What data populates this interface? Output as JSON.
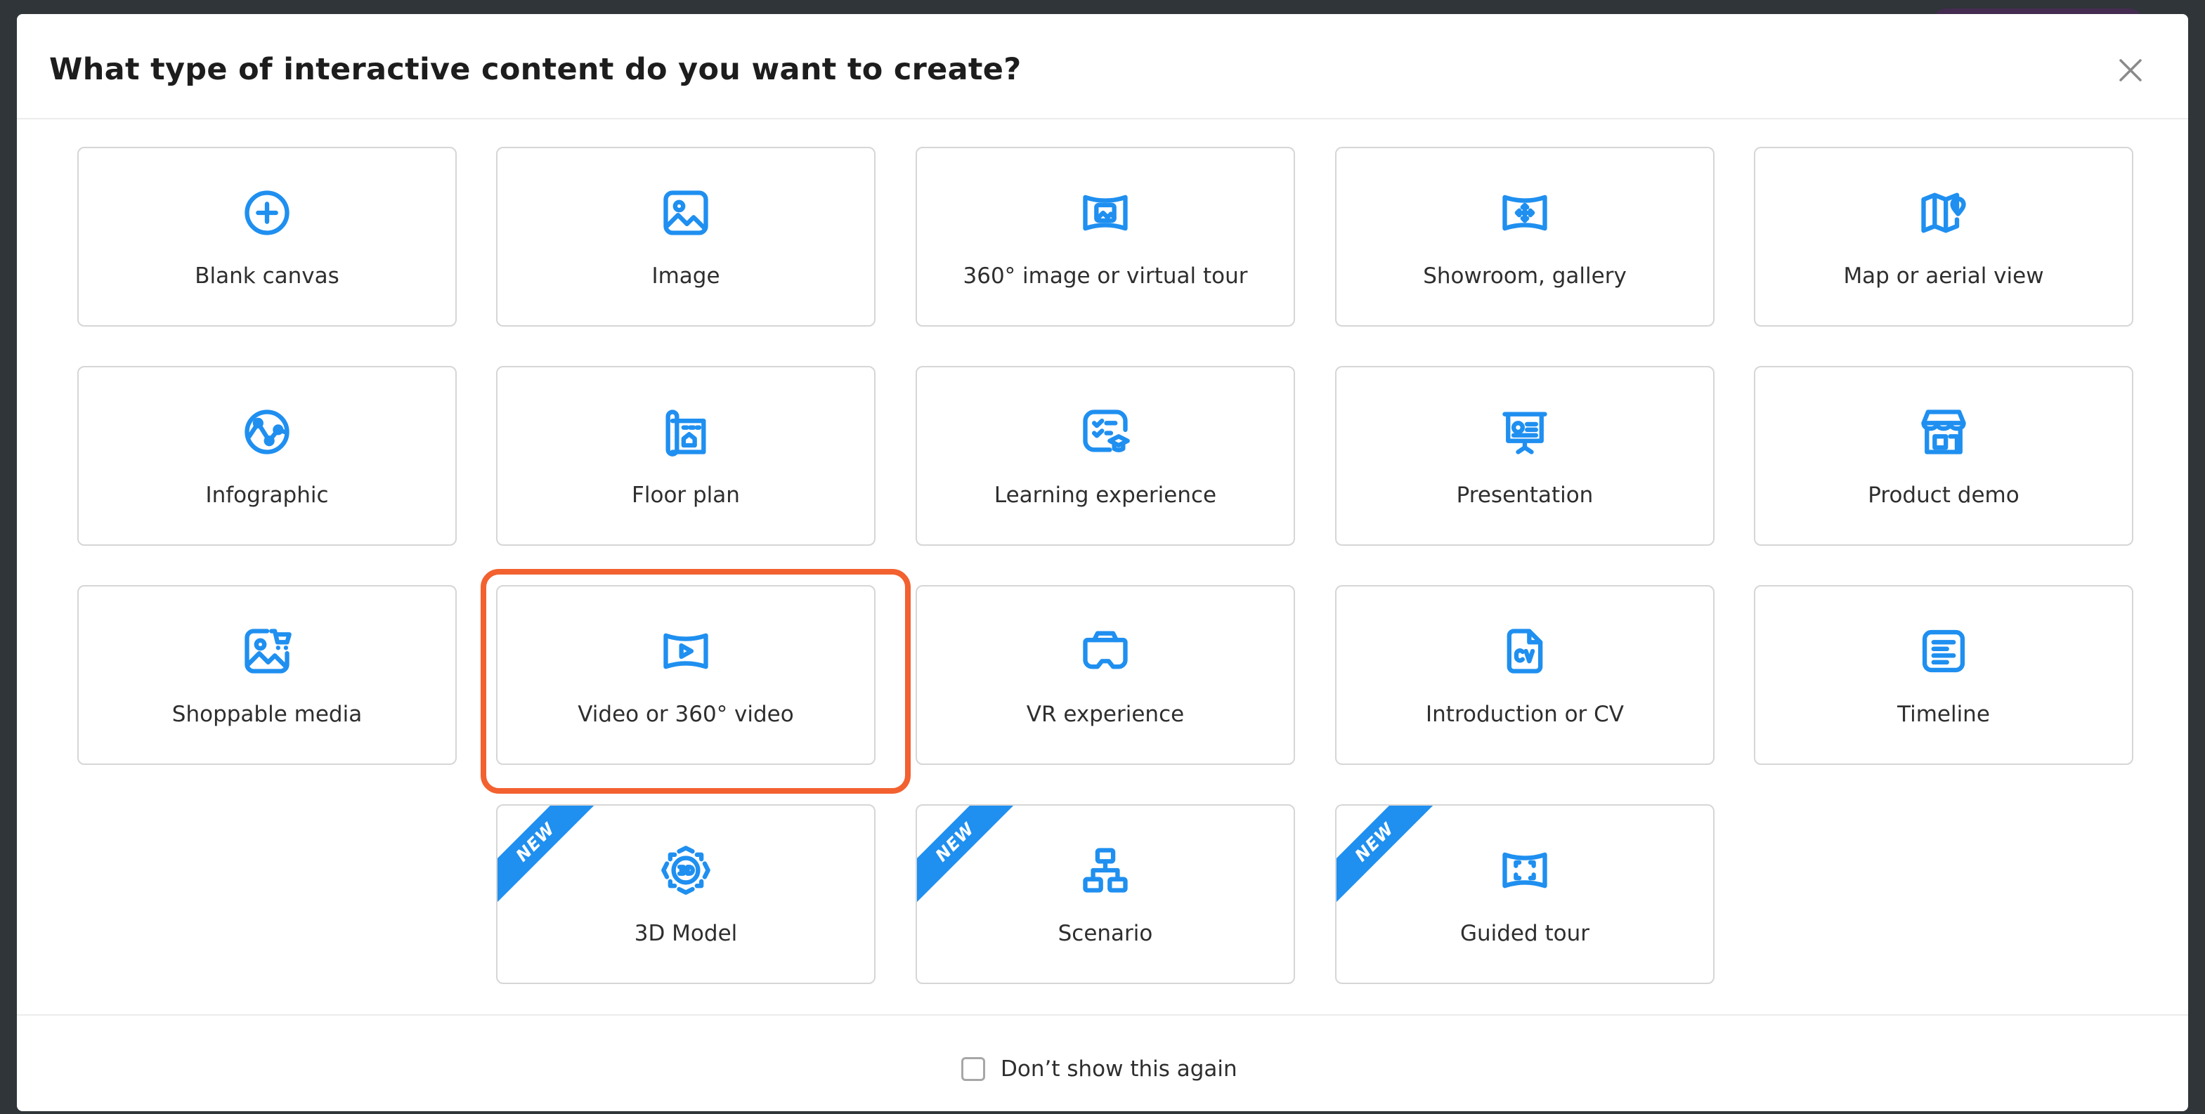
{
  "dialog": {
    "title": "What type of interactive content do you want to create?",
    "close_icon": "close-icon"
  },
  "accent_color": "#1f8ff0",
  "highlight_color": "#f2612f",
  "new_badge": "NEW",
  "cards": [
    {
      "label": "Blank canvas",
      "icon": "plus-circle-icon"
    },
    {
      "label": "Image",
      "icon": "image-icon"
    },
    {
      "label": "360° image or virtual tour",
      "icon": "panorama-image-icon"
    },
    {
      "label": "Showroom, gallery",
      "icon": "showroom-move-icon"
    },
    {
      "label": "Map or aerial view",
      "icon": "map-pin-icon"
    },
    {
      "label": "Infographic",
      "icon": "infographic-icon"
    },
    {
      "label": "Floor plan",
      "icon": "floor-plan-icon"
    },
    {
      "label": "Learning experience",
      "icon": "learning-icon"
    },
    {
      "label": "Presentation",
      "icon": "presentation-board-icon"
    },
    {
      "label": "Product demo",
      "icon": "storefront-icon"
    },
    {
      "label": "Shoppable media",
      "icon": "shoppable-image-cart-icon"
    },
    {
      "label": "Video or 360° video",
      "icon": "panorama-video-icon",
      "highlighted": true
    },
    {
      "label": "VR experience",
      "icon": "vr-headset-icon"
    },
    {
      "label": "Introduction or CV",
      "icon": "cv-document-icon"
    },
    {
      "label": "Timeline",
      "icon": "timeline-list-icon"
    },
    {
      "label": "3D Model",
      "icon": "3d-cube-icon",
      "badge": "NEW"
    },
    {
      "label": "Scenario",
      "icon": "scenario-tree-icon",
      "badge": "NEW"
    },
    {
      "label": "Guided tour",
      "icon": "guided-tour-frame-icon",
      "badge": "NEW"
    }
  ],
  "footer": {
    "checkbox_label": "Don’t show this again",
    "checked": false
  }
}
